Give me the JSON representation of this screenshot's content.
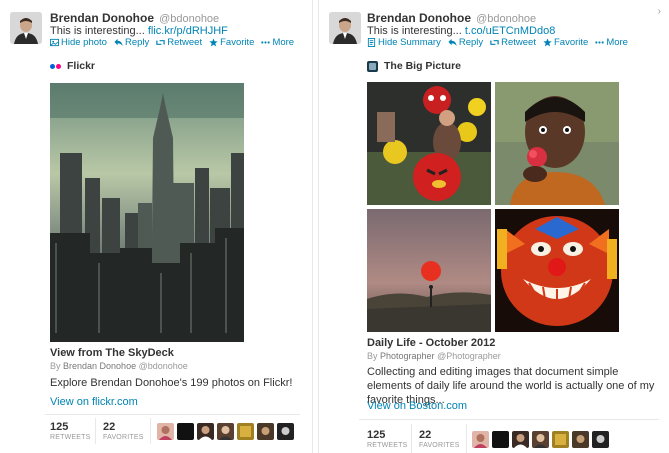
{
  "left_tweet": {
    "name": "Brendan Donohoe",
    "handle": "@bdonohoe",
    "text": "This is interesting... ",
    "link": "flic.kr/p/dRHJHF",
    "actions": {
      "hide": "Hide photo",
      "reply": "Reply",
      "retweet": "Retweet",
      "favorite": "Favorite",
      "more": "More"
    },
    "source": "Flickr",
    "card": {
      "title": "View from The SkyDeck",
      "by_prefix": "By ",
      "by_name": "Brendan Donohoe",
      "by_handle": " @bdonohoe",
      "description": "Explore Brendan Donohoe's 199 photos on Flickr!",
      "link": "View on flickr.com"
    },
    "retweets": "125",
    "retweets_label": "RETWEETS",
    "favorites": "22",
    "favorites_label": "FAVORITES"
  },
  "right_tweet": {
    "name": "Brendan Donohoe",
    "handle": "@bdonohoe",
    "text": "This is interesting... ",
    "link": "t.co/uETCnMDdo8",
    "actions": {
      "hide": "Hide Summary",
      "reply": "Reply",
      "retweet": "Retweet",
      "favorite": "Favorite",
      "more": "More"
    },
    "source": "The Big Picture",
    "card": {
      "title": "Daily Life - October 2012",
      "by_prefix": "By ",
      "by_name": "Photographer",
      "by_handle": " @Photographer",
      "description": "Collecting and editing images that document simple elements of daily life around the world is actually one of my favorite things...",
      "link": "View on Boston.com"
    },
    "retweets": "125",
    "retweets_label": "RETWEETS",
    "favorites": "22",
    "favorites_label": "FAVORITES"
  },
  "colors": {
    "link": "#0084b4",
    "text": "#333333",
    "muted": "#999999",
    "flickr_blue": "#0063dc",
    "flickr_pink": "#ff0084"
  }
}
